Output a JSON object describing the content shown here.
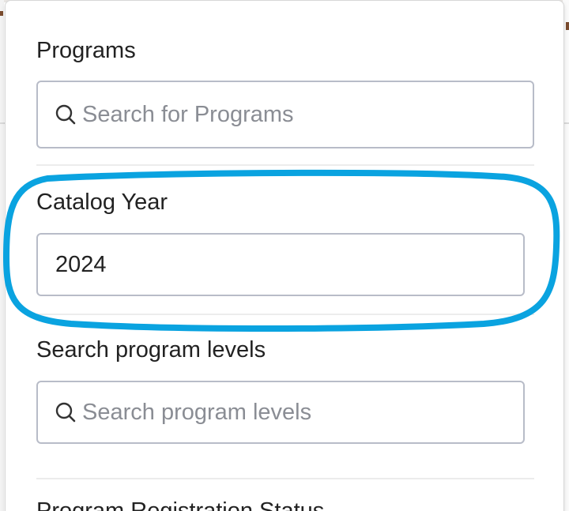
{
  "panel": {
    "programs": {
      "label": "Programs",
      "placeholder": "Search for Programs"
    },
    "catalog_year": {
      "label": "Catalog Year",
      "value": "2024"
    },
    "program_levels": {
      "label": "Search program levels",
      "placeholder": "Search program levels"
    },
    "next_section_label": "Program Registration Status"
  },
  "highlight": {
    "color": "#0aa3e0",
    "target": "catalog-year-section"
  },
  "icons": {
    "search": "search-icon"
  }
}
